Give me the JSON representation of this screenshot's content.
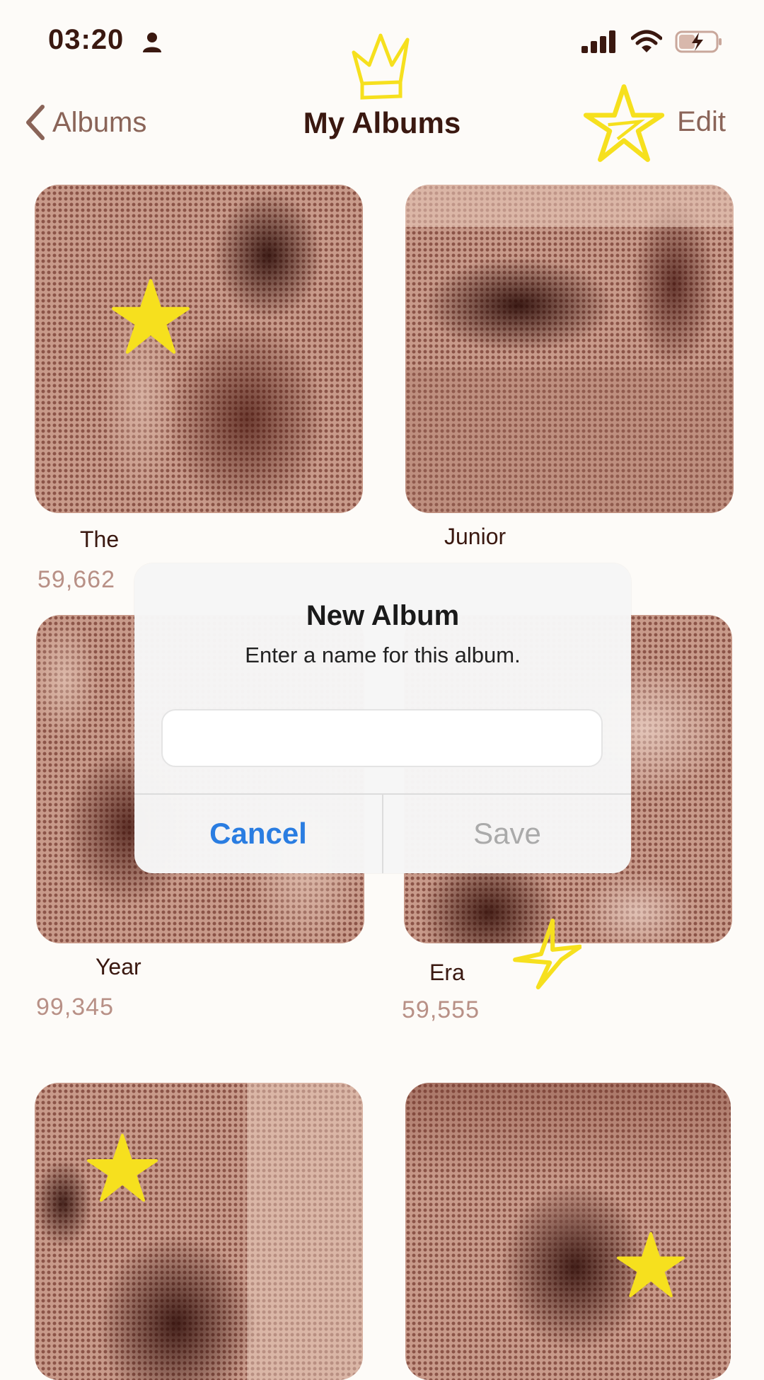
{
  "status_bar": {
    "time": "03:20"
  },
  "nav": {
    "back_label": "Albums",
    "title": "My Albums",
    "edit_label": "Edit"
  },
  "albums": [
    {
      "name": "The",
      "count": "59,662"
    },
    {
      "name": "Junior",
      "count": ""
    },
    {
      "name": "Year",
      "count": "99,345"
    },
    {
      "name": "Era",
      "count": "59,555"
    },
    {
      "name": "",
      "count": ""
    },
    {
      "name": "",
      "count": ""
    }
  ],
  "dialog": {
    "title": "New Album",
    "message": "Enter a name for this album.",
    "input_value": "",
    "input_placeholder": "",
    "cancel_label": "Cancel",
    "save_label": "Save"
  },
  "colors": {
    "accent": "#2a7de1",
    "photo_tint": "#c89a8a",
    "photo_dots": "#5a1c12",
    "doodle_yellow": "#f6e01e",
    "text_dark": "#3a1810",
    "text_muted": "#8a6458"
  },
  "icons": [
    "person-icon",
    "cellular-signal-icon",
    "wifi-icon",
    "battery-charging-icon",
    "chevron-left-icon",
    "crown-doodle-icon",
    "star-doodle-icon"
  ]
}
